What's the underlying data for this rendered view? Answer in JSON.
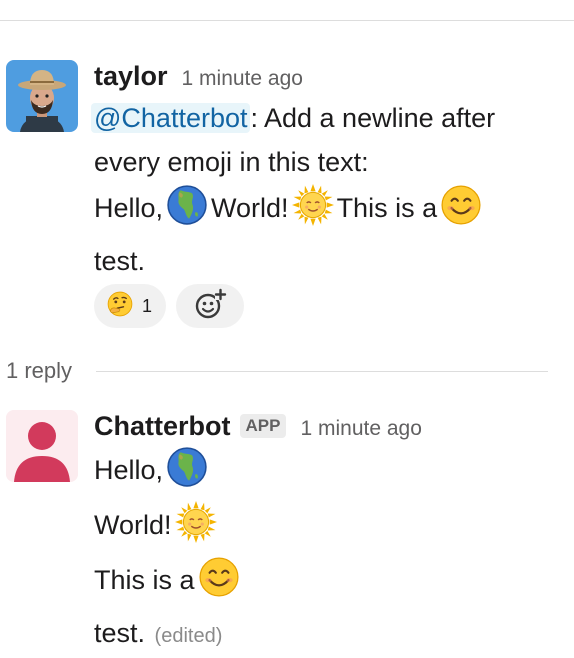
{
  "messages": [
    {
      "author": "taylor",
      "timestamp": "1 minute ago",
      "avatar": "cowboy-avatar",
      "mention": "@Chatterbot",
      "lines": [
        ": Add a newline after",
        "every emoji in this text:",
        "Hello,",
        "World!",
        "This is a",
        "test."
      ],
      "emojis": [
        "earth-africa-emoji",
        "sun-with-face-emoji",
        "smiling-face-emoji"
      ],
      "reactions": [
        {
          "emoji": "thinking-face-emoji",
          "count": "1"
        }
      ],
      "add_reaction_icon": "add-reaction-icon"
    },
    {
      "author": "Chatterbot",
      "badge": "APP",
      "timestamp": "1 minute ago",
      "avatar": "default-user-avatar",
      "lines": [
        "Hello,",
        "World!",
        "This is a",
        "test."
      ],
      "edited_label": "(edited)"
    }
  ],
  "thread": {
    "reply_count": "1 reply"
  },
  "colors": {
    "mention_text": "#1264a3",
    "mention_bg": "#e8f5fa",
    "bot_avatar": "#d23a5c",
    "bot_avatar_bg": "#fcecef"
  }
}
